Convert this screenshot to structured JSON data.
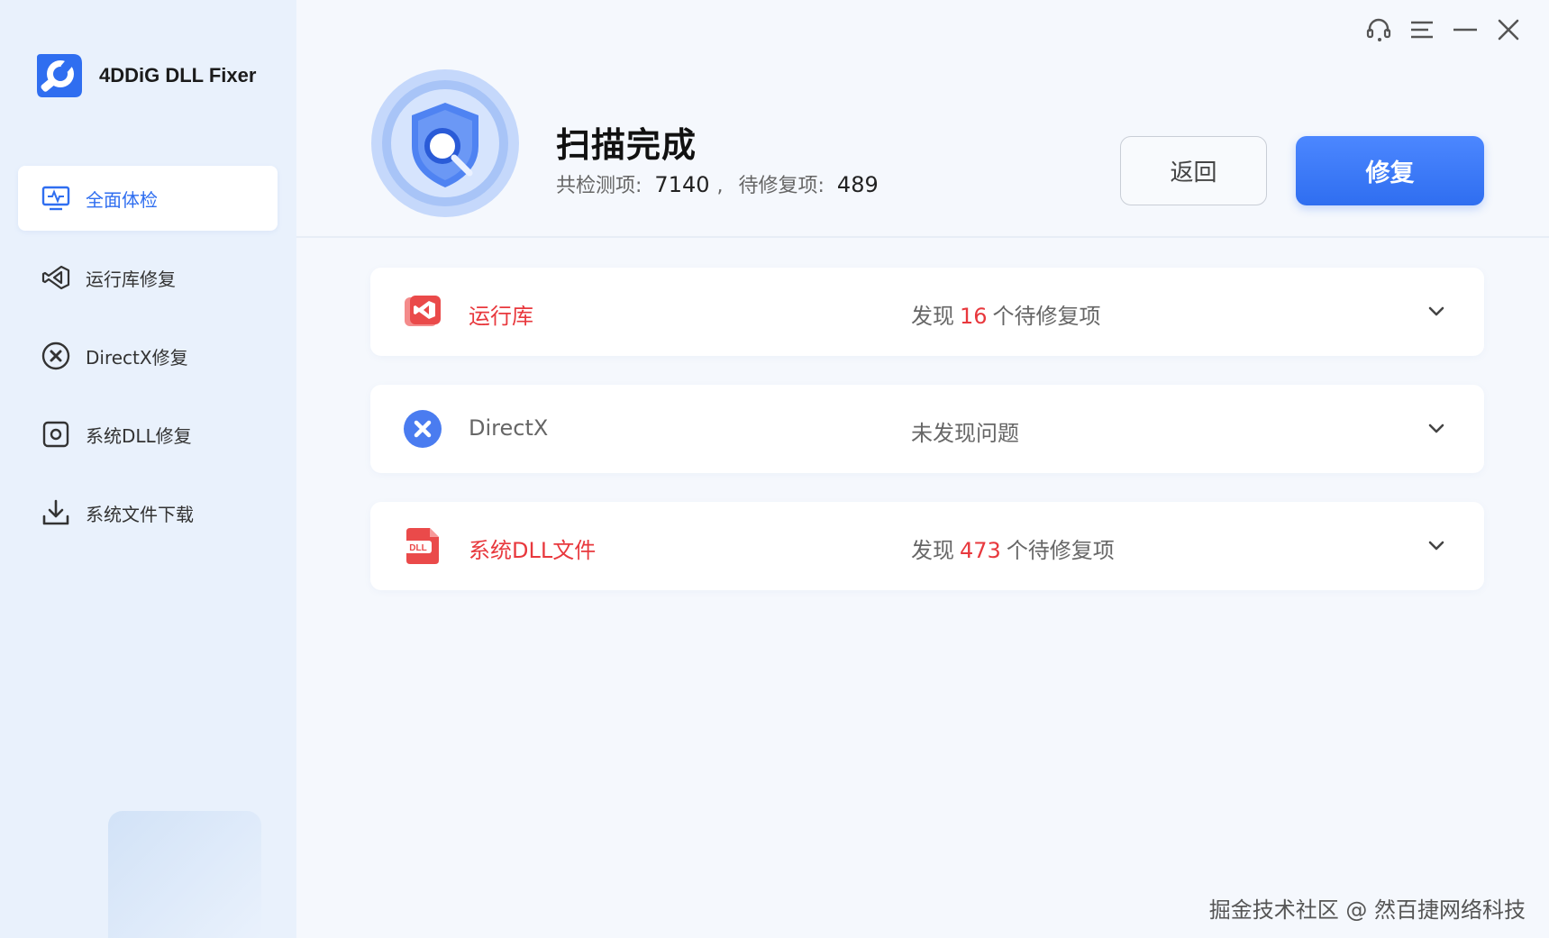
{
  "app": {
    "name": "4DDiG DLL Fixer"
  },
  "sidebar": {
    "items": [
      {
        "label": "全面体检",
        "icon": "monitor-pulse-icon",
        "active": true
      },
      {
        "label": "运行库修复",
        "icon": "visual-studio-icon",
        "active": false
      },
      {
        "label": "DirectX修复",
        "icon": "directx-icon",
        "active": false
      },
      {
        "label": "系统DLL修复",
        "icon": "system-dll-icon",
        "active": false
      },
      {
        "label": "系统文件下载",
        "icon": "download-icon",
        "active": false
      }
    ]
  },
  "window_controls": [
    "headset-icon",
    "menu-icon",
    "minimize-icon",
    "close-icon"
  ],
  "scan": {
    "title": "扫描完成",
    "total_label": "共检测项:",
    "total_value": "7140",
    "separator": ",",
    "pending_label": "待修复项:",
    "pending_value": "489"
  },
  "buttons": {
    "back": "返回",
    "fix": "修复"
  },
  "results": [
    {
      "title": "运行库",
      "status_prefix": "发现",
      "count": "16",
      "status_suffix": "个待修复项",
      "status_plain": "",
      "color": "#e8383d",
      "icon": "runtime-library-icon"
    },
    {
      "title": "DirectX",
      "status_prefix": "",
      "count": "",
      "status_suffix": "",
      "status_plain": "未发现问题",
      "color": "#666666",
      "icon": "directx-icon"
    },
    {
      "title": "系统DLL文件",
      "status_prefix": "发现",
      "count": "473",
      "status_suffix": "个待修复项",
      "status_plain": "",
      "color": "#e8383d",
      "icon": "dll-file-icon"
    }
  ],
  "watermark": "掘金技术社区 @ 然百捷网络科技",
  "colors": {
    "accent": "#2f6ef0",
    "danger": "#e8383d",
    "sidebar_bg": "#e9f1fc"
  }
}
